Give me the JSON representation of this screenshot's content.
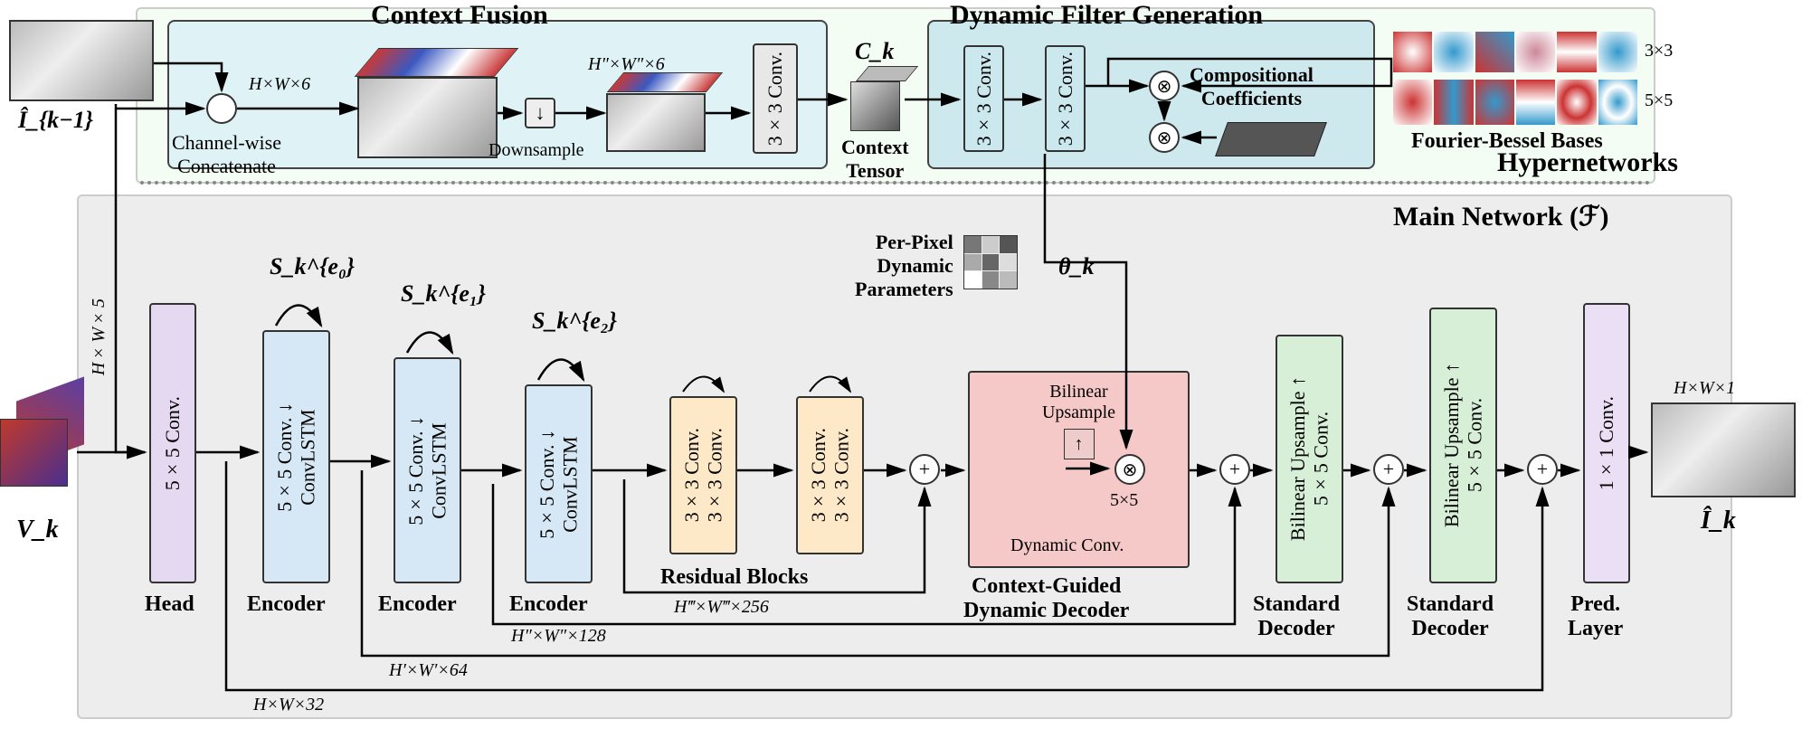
{
  "regions": {
    "context_fusion": "Context Fusion",
    "dynamic_filter_generation": "Dynamic Filter Generation",
    "hypernetworks": "Hypernetworks",
    "main_network": "Main Network  (ℱ)"
  },
  "inputs": {
    "i_prev": "Î_{k−1}",
    "v_k": "V_k",
    "i_out": "Î_k"
  },
  "cf": {
    "concat": "Channel-wise\nConcatenate",
    "dim_in": "H×W×6",
    "downsample": "Downsample",
    "dim_ds": "H″×W″×6",
    "conv33": "3×3 Conv.",
    "context_tensor_sym": "C_k",
    "context_tensor_lbl": "Context\nTensor",
    "input_dim": "H×W×5"
  },
  "dfg": {
    "conv1": "3×3 Conv.",
    "conv2": "3×3 Conv.",
    "comp_coeff": "Compositional\nCoefficients",
    "bases": "Fourier-Bessel Bases",
    "b3": "3×3",
    "b5": "5×5",
    "theta": "θ_k",
    "pp_params": "Per-Pixel\nDynamic\nParameters"
  },
  "main": {
    "head": "5×5 Conv.",
    "head_lbl": "Head",
    "enc": "5×5 Conv. ↓\nConvLSTM",
    "enc_lbl": "Encoder",
    "s0": "S_k^{e₀}",
    "s1": "S_k^{e₁}",
    "s2": "S_k^{e₂}",
    "res": "3×3 Conv.\n3×3 Conv.",
    "res_lbl": "Residual Blocks",
    "dyn_up": "Bilinear\nUpsample",
    "dyn_sym": "↑",
    "dyn_conv": "5×5",
    "dyn_conv_lbl": "Dynamic Conv.",
    "dyn_lbl": "Context-Guided\nDynamic Decoder",
    "dec": "Bilinear Upsample ↑\n5×5 Conv.",
    "dec_lbl": "Standard\nDecoder",
    "pred": "1×1 Conv.",
    "pred_lbl": "Pred.\nLayer",
    "out_dim": "H×W×1",
    "skip256": "H‴×W‴×256",
    "skip128": "H″×W″×128",
    "skip64": "H′×W′×64",
    "skip32": "H×W×32"
  }
}
